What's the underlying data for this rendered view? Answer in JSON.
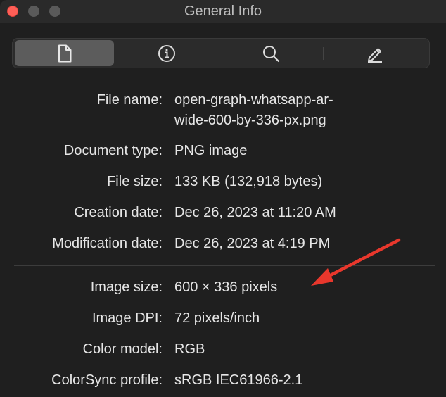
{
  "window": {
    "title": "General Info"
  },
  "toolbar": {
    "tabs": [
      {
        "name": "general",
        "icon": "document-icon",
        "selected": true
      },
      {
        "name": "more-info",
        "icon": "info-circle-icon",
        "selected": false
      },
      {
        "name": "search",
        "icon": "search-icon",
        "selected": false
      },
      {
        "name": "annotate",
        "icon": "pencil-icon",
        "selected": false
      }
    ]
  },
  "info": {
    "file_name_label": "File name:",
    "file_name_line1": "open-graph-whatsapp-ar-",
    "file_name_line2": "wide-600-by-336-px.png",
    "document_type_label": "Document type:",
    "document_type": "PNG image",
    "file_size_label": "File size:",
    "file_size": "133 KB (132,918 bytes)",
    "creation_date_label": "Creation date:",
    "creation_date": "Dec 26, 2023 at 11:20 AM",
    "modification_date_label": "Modification date:",
    "modification_date": "Dec 26, 2023 at 4:19 PM",
    "image_size_label": "Image size:",
    "image_size": "600 × 336 pixels",
    "image_dpi_label": "Image DPI:",
    "image_dpi": "72 pixels/inch",
    "color_model_label": "Color model:",
    "color_model": "RGB",
    "colorsync_label": "ColorSync profile:",
    "colorsync": "sRGB IEC61966-2.1"
  },
  "colors": {
    "annotation_arrow": "#e8372c",
    "close_button": "#ff5f57",
    "selected_segment": "#5c5c5c"
  }
}
